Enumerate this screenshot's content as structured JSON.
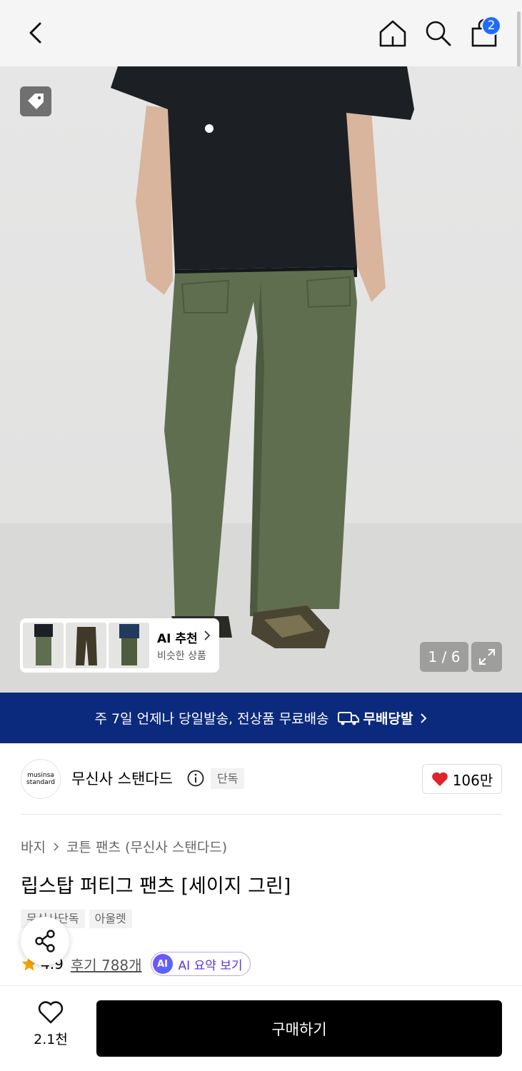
{
  "header": {
    "cart_count": "2"
  },
  "gallery": {
    "counter": "1 / 6",
    "ai_recommend_title": "AI 추천",
    "ai_recommend_sub": "비슷한 상품"
  },
  "promo": {
    "text": "주 7일 언제나 당일발송, 전상품 무료배송",
    "brand": "무배당발"
  },
  "brand": {
    "logo_line1": "musinsa",
    "logo_line2": "standard",
    "name": "무신사 스탠다드",
    "badge": "단독",
    "likes": "106만"
  },
  "product": {
    "breadcrumb": [
      "바지",
      "코튼 팬츠 (무신사 스탠다드)"
    ],
    "title": "립스탑 퍼티그 팬츠 [세이지 그린]",
    "chips": [
      "무신사단독",
      "아울렛"
    ],
    "rating": "4.9",
    "reviews": "후기 788개",
    "ai_summary_logo": "AI",
    "ai_summary": "AI 요약 보기"
  },
  "bottom": {
    "fav_count": "2.1천",
    "buy_label": "구매하기"
  },
  "colors": {
    "promo_bg": "#0c2a7d",
    "badge_blue": "#1e6bff",
    "heart_red": "#e0242b",
    "star_orange": "#f7a400",
    "pants_green": "#5f6e4f",
    "shirt_black": "#1c2024"
  }
}
